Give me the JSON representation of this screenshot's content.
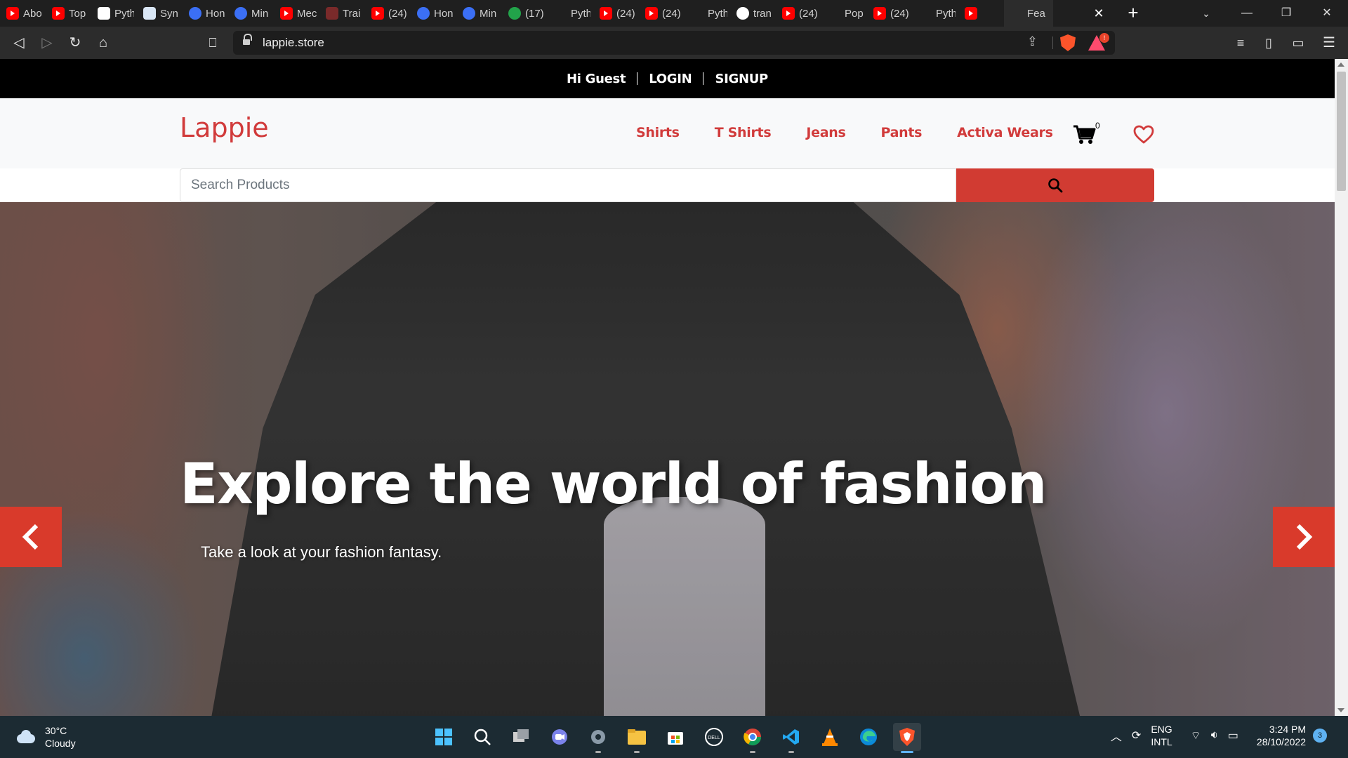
{
  "browser": {
    "tabs": [
      {
        "title": "Abo",
        "icon": "youtube-icon",
        "kind": "yt"
      },
      {
        "title": "Top",
        "icon": "youtube-icon",
        "kind": "yt"
      },
      {
        "title": "Pyth",
        "icon": "code-icon",
        "kind": "gh"
      },
      {
        "title": "Syn",
        "icon": "grid-icon",
        "kind": "sy"
      },
      {
        "title": "Hon",
        "icon": "c-icon",
        "kind": "c"
      },
      {
        "title": "Min",
        "icon": "c-icon",
        "kind": "c"
      },
      {
        "title": "Mec",
        "icon": "youtube-icon",
        "kind": "yt"
      },
      {
        "title": "Trai",
        "icon": "s-icon",
        "kind": "s"
      },
      {
        "title": "(24)",
        "icon": "youtube-icon",
        "kind": "yt"
      },
      {
        "title": "Hon",
        "icon": "c-icon",
        "kind": "c"
      },
      {
        "title": "Min",
        "icon": "c-icon",
        "kind": "c"
      },
      {
        "title": "(17)",
        "icon": "whatsapp-icon",
        "kind": "gr"
      },
      {
        "title": "Pyth",
        "icon": "w-icon",
        "kind": "w"
      },
      {
        "title": "(24)",
        "icon": "youtube-icon",
        "kind": "yt"
      },
      {
        "title": "(24)",
        "icon": "youtube-icon",
        "kind": "yt"
      },
      {
        "title": "Pyth",
        "icon": "p-icon",
        "kind": "p"
      },
      {
        "title": "tran",
        "icon": "google-icon",
        "kind": "g"
      },
      {
        "title": "(24)",
        "icon": "youtube-icon",
        "kind": "yt"
      },
      {
        "title": "Pop",
        "icon": "java-icon",
        "kind": "j"
      },
      {
        "title": "(24)",
        "icon": "youtube-icon",
        "kind": "yt"
      },
      {
        "title": "Pyth",
        "icon": "link-icon",
        "kind": "w"
      },
      {
        "title": "",
        "icon": "youtube-icon",
        "kind": "yt"
      },
      {
        "title": "Fea",
        "icon": "chat-icon",
        "kind": "ch"
      }
    ],
    "url": "lappie.store"
  },
  "site": {
    "topbar": {
      "greeting": "Hi Guest",
      "login": "LOGIN",
      "signup": "SIGNUP"
    },
    "logo": "Lappie",
    "nav": [
      "Shirts",
      "T Shirts",
      "Jeans",
      "Pants",
      "Activa Wears"
    ],
    "cart_count": "0",
    "search": {
      "placeholder": "Search Products"
    },
    "hero": {
      "title": "Explore the world of fashion",
      "subtitle": "Take a look at your fashion fantasy."
    },
    "accent_color": "#d13b3b"
  },
  "taskbar": {
    "weather": {
      "temp": "30°C",
      "condition": "Cloudy"
    },
    "apps": [
      "start-icon",
      "search-icon",
      "task-view-icon",
      "chat-icon",
      "settings-icon",
      "file-explorer-icon",
      "store-icon",
      "dell-icon",
      "chrome-icon",
      "vscode-icon",
      "vlc-icon",
      "edge-icon",
      "brave-icon"
    ],
    "lang": {
      "line1": "ENG",
      "line2": "INTL"
    },
    "time": "3:24 PM",
    "date": "28/10/2022",
    "notifications": "3"
  }
}
